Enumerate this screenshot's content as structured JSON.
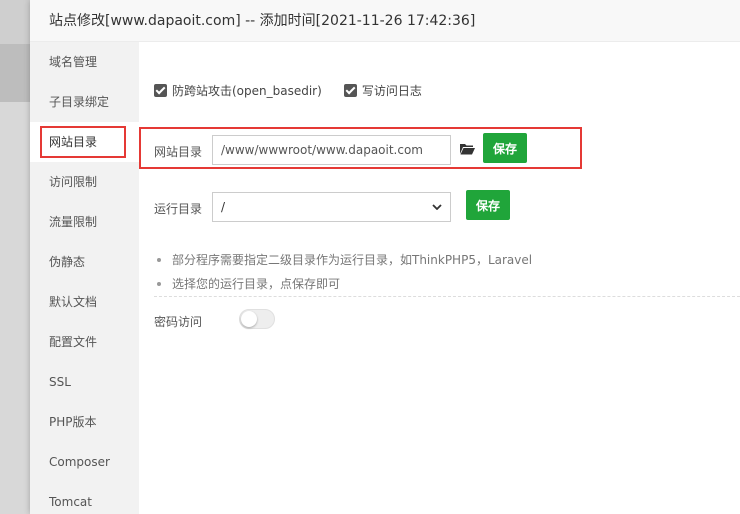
{
  "dialog": {
    "title": "站点修改[www.dapaoit.com] -- 添加时间[2021-11-26 17:42:36]"
  },
  "sidebar": {
    "active_index": 2,
    "items": [
      {
        "label": "域名管理"
      },
      {
        "label": "子目录绑定"
      },
      {
        "label": "网站目录"
      },
      {
        "label": "访问限制"
      },
      {
        "label": "流量限制"
      },
      {
        "label": "伪静态"
      },
      {
        "label": "默认文档"
      },
      {
        "label": "配置文件"
      },
      {
        "label": "SSL"
      },
      {
        "label": "PHP版本"
      },
      {
        "label": "Composer"
      },
      {
        "label": "Tomcat"
      }
    ]
  },
  "options": {
    "anti_xss": {
      "label": "防跨站攻击(open_basedir)",
      "checked": true
    },
    "access_log": {
      "label": "写访问日志",
      "checked": true
    }
  },
  "site_dir": {
    "label": "网站目录",
    "value": "/www/wwwroot/www.dapaoit.com",
    "folder_icon": "folder-open-icon",
    "save_label": "保存"
  },
  "run_dir": {
    "label": "运行目录",
    "selected": "/",
    "save_label": "保存"
  },
  "tips": [
    "部分程序需要指定二级目录作为运行目录，如ThinkPHP5，Laravel",
    "选择您的运行目录，点保存即可"
  ],
  "password_access": {
    "label": "密码访问",
    "enabled": false
  },
  "colors": {
    "accent": "#20a53a",
    "highlight": "#e53935"
  }
}
